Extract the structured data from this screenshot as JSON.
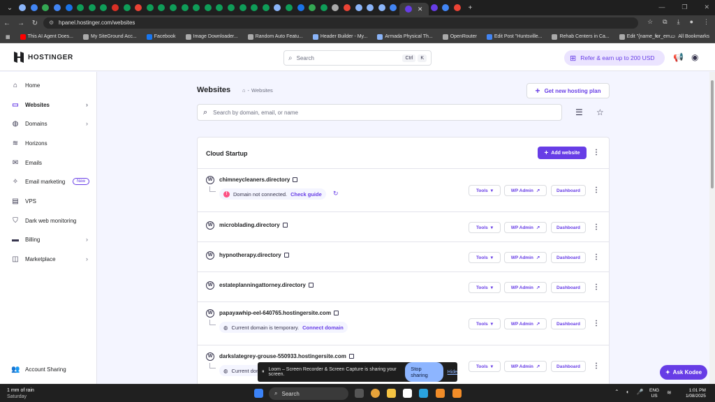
{
  "browser": {
    "url": "hpanel.hostinger.com/websites",
    "tab_favicon_colors": [
      "#8ab4f8",
      "#4285f4",
      "#34a853",
      "#4285f4",
      "#1a73e8",
      "#0f9d58",
      "#0f9d58",
      "#0f9d58",
      "#d93025",
      "#0f9d58",
      "#ea4335",
      "#0f9d58",
      "#0f9d58",
      "#0f9d58",
      "#0f9d58",
      "#0f9d58",
      "#0f9d58",
      "#0f9d58",
      "#0f9d58",
      "#0f9d58",
      "#0f9d58",
      "#0f9d58",
      "#8ab4f8",
      "#0f9d58",
      "#1a73e8",
      "#34a853",
      "#0f9d58",
      "#aaaaaa",
      "#ea4335",
      "#8ab4f8",
      "#8ab4f8",
      "#8ab4f8",
      "#4285f4",
      "#673de6",
      "#4285f4",
      "#ea4335"
    ],
    "bookmarks": [
      {
        "label": "This AI Agent Does...",
        "color": "#ff0000"
      },
      {
        "label": "My SiteGround Acc...",
        "color": "#aaaaaa"
      },
      {
        "label": "Facebook",
        "color": "#1877f2"
      },
      {
        "label": "Image Downloader...",
        "color": "#aaaaaa"
      },
      {
        "label": "Random Auto Featu...",
        "color": "#aaaaaa"
      },
      {
        "label": "Header Builder - My...",
        "color": "#8ab4f8"
      },
      {
        "label": "Armada Physical Th...",
        "color": "#8ab4f8"
      },
      {
        "label": "OpenRouter",
        "color": "#aaaaaa"
      },
      {
        "label": "Edit Post \"Huntsville...",
        "color": "#4285f4"
      },
      {
        "label": "Rehab Centers in Ca...",
        "color": "#aaaaaa"
      },
      {
        "label": "Edit \"{name_for_em...",
        "color": "#aaaaaa"
      }
    ],
    "all_bookmarks": "All Bookmarks"
  },
  "header": {
    "logo_text": "HOSTINGER",
    "search_placeholder": "Search",
    "kbd_ctrl": "Ctrl",
    "kbd_k": "K",
    "refer_label": "Refer & earn up to 200 USD"
  },
  "sidebar": {
    "items": [
      {
        "label": "Home",
        "icon": "home-icon"
      },
      {
        "label": "Websites",
        "icon": "websites-icon"
      },
      {
        "label": "Domains",
        "icon": "globe-icon"
      },
      {
        "label": "Horizons",
        "icon": "horizons-icon"
      },
      {
        "label": "Emails",
        "icon": "mail-icon"
      },
      {
        "label": "Email marketing",
        "icon": "email-marketing-icon",
        "badge": "New"
      },
      {
        "label": "VPS",
        "icon": "server-icon"
      },
      {
        "label": "Dark web monitoring",
        "icon": "shield-icon"
      },
      {
        "label": "Billing",
        "icon": "billing-icon"
      },
      {
        "label": "Marketplace",
        "icon": "marketplace-icon"
      }
    ],
    "account_sharing": "Account Sharing"
  },
  "main": {
    "title": "Websites",
    "breadcrumb_separator": "-",
    "breadcrumb": "Websites",
    "new_plan_label": "Get new hosting plan",
    "domain_search_placeholder": "Search by domain, email, or name"
  },
  "card": {
    "title": "Cloud Startup",
    "add_website_label": "Add website",
    "tools_label": "Tools",
    "wp_admin_label": "WP Admin",
    "dashboard_label": "Dashboard",
    "websites": [
      {
        "domain": "chimneycleaners.directory",
        "status": "Domain not connected.",
        "status_link": "Check guide",
        "status_type": "error"
      },
      {
        "domain": "microblading.directory"
      },
      {
        "domain": "hypnotherapy.directory"
      },
      {
        "domain": "estateplanningattorney.directory"
      },
      {
        "domain": "papayawhip-eel-640765.hostingersite.com",
        "status": "Current domain is temporary.",
        "status_link": "Connect domain",
        "status_type": "temp"
      },
      {
        "domain": "darkslategrey-grouse-550933.hostingersite.com",
        "status": "Current domain is temporary.",
        "status_type": "temp"
      }
    ]
  },
  "ask_kodee": "Ask Kodee",
  "loom": {
    "message": "Loom – Screen Recorder & Screen Capture is sharing your screen.",
    "stop_label": "Stop sharing",
    "hide_label": "Hide"
  },
  "taskbar": {
    "weather_title": "1 mm of rain",
    "weather_day": "Saturday",
    "search_label": "Search",
    "lang": "ENG",
    "region": "US",
    "time": "1:01 PM",
    "date": "1/08/2025"
  },
  "colors": {
    "brand": "#673de6",
    "error": "#fc5185"
  }
}
